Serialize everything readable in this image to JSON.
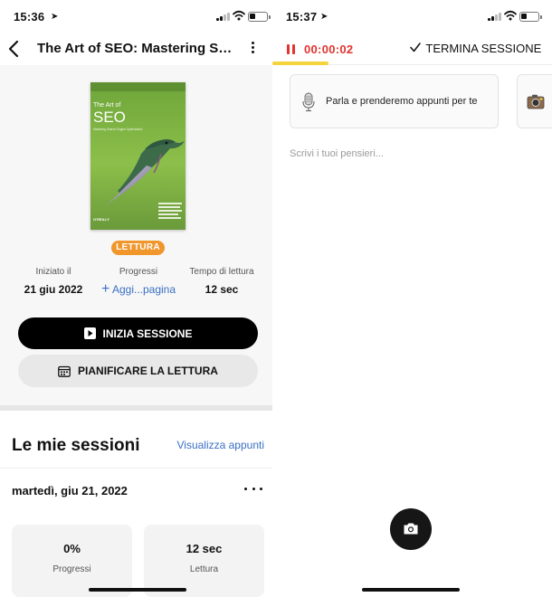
{
  "left": {
    "status": {
      "time": "15:36"
    },
    "header": {
      "title": "The Art of SEO: Mastering Search Engine Optimization"
    },
    "book": {
      "cover_title_line1": "The Art of",
      "cover_title_line2": "SEO",
      "cover_subtitle": "Mastering Search Engine Optimization",
      "publisher": "O'REILLY",
      "status_badge": "LETTURA"
    },
    "stats": {
      "started_label": "Iniziato il",
      "started_value": "21 giu 2022",
      "progress_label": "Progressi",
      "progress_link": "Aggi...pagina",
      "time_label": "Tempo di lettura",
      "time_value": "12 sec"
    },
    "buttons": {
      "start_session": "INIZIA SESSIONE",
      "plan_reading": "PIANIFICARE LA LETTURA"
    },
    "sessions": {
      "title": "Le mie sessioni",
      "view_notes": "Visualizza appunti",
      "date": "martedì, giu 21, 2022",
      "cards": [
        {
          "value": "0%",
          "label": "Progressi"
        },
        {
          "value": "12 sec",
          "label": "Lettura"
        }
      ]
    }
  },
  "right": {
    "status": {
      "time": "15:37"
    },
    "timer": "00:00:02",
    "end_session": "TERMINA SESSIONE",
    "voice_prompt": "Parla e prenderemo appunti per te",
    "notes_placeholder": "Scrivi i tuoi pensieri..."
  },
  "colors": {
    "accent_red": "#e0342f",
    "badge_orange": "#f0962a",
    "link_blue": "#3a6fc4",
    "timer_underline": "#f5d33a"
  }
}
